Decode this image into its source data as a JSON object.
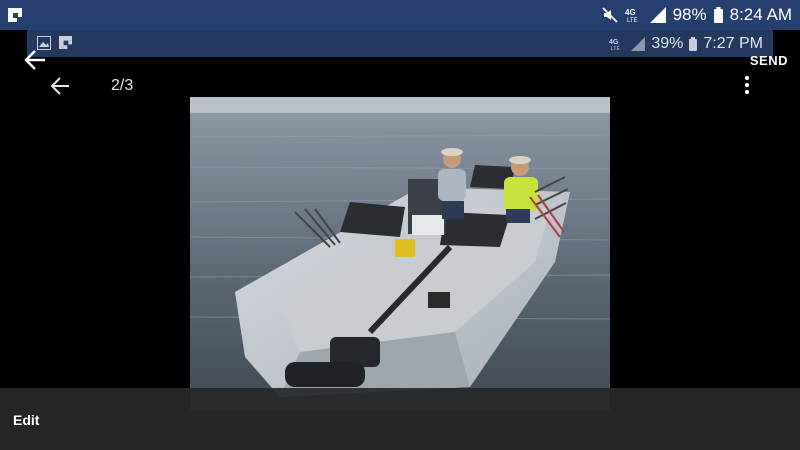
{
  "status_bar": {
    "battery": "98%",
    "time": "8:24 AM",
    "network": "4G LTE",
    "icons": [
      "flipboard-icon",
      "mute-icon",
      "lte-icon",
      "signal-icon",
      "battery-icon"
    ]
  },
  "inner_status": {
    "battery": "39%",
    "time": "7:27 PM",
    "network": "4G LTE",
    "icons": [
      "image-icon",
      "flipboard-icon",
      "lte-icon",
      "signal-icon",
      "battery-icon"
    ]
  },
  "top_actions": {
    "send_label": "SEND"
  },
  "viewer": {
    "counter": "2/3",
    "photo_alt": "image",
    "photo_icon": "photo-image"
  },
  "bottom_bar": {
    "edit_label": "Edit"
  },
  "colors": {
    "status_bar": "#25406e",
    "inner_status": "#23395f",
    "background": "#000000"
  }
}
